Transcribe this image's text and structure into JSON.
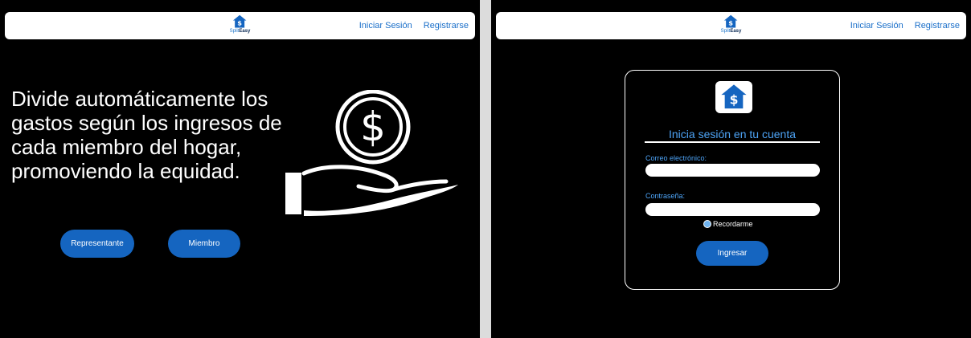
{
  "brand": {
    "name_part1": "Split",
    "name_part2": "Easy"
  },
  "nav": {
    "login": "Iniciar Sesión",
    "register": "Registrarse"
  },
  "hero": {
    "text": "Divide automáticamente los gastos según los ingresos de cada miembro del hogar, promoviendo la equidad.",
    "button_representative": "Representante",
    "button_member": "Miembro"
  },
  "login": {
    "title": "Inicia sesión en tu cuenta",
    "email_label": "Correo electrónico:",
    "email_value": "",
    "password_label": "Contraseña:",
    "password_value": "",
    "remember_label": "Recordarme",
    "submit_label": "Ingresar"
  },
  "colors": {
    "accent": "#1565c0",
    "link": "#1a6fc9",
    "label": "#4da3f5",
    "background": "#000000"
  },
  "icons": [
    "house-dollar-logo-icon",
    "dollar-coin-icon",
    "open-hand-icon"
  ]
}
